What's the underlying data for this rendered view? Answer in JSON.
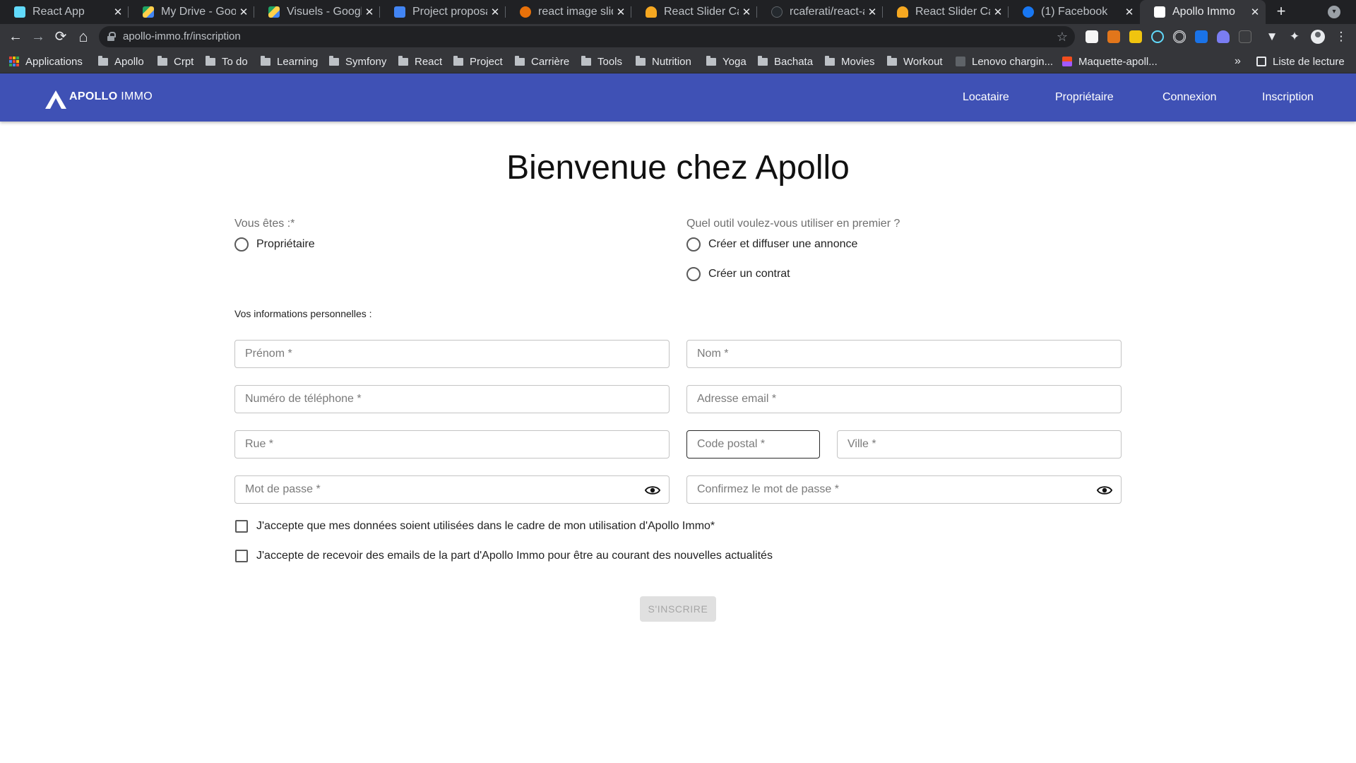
{
  "browser": {
    "tabs": [
      {
        "title": "React App",
        "favicon_color": "#61dafb"
      },
      {
        "title": "My Drive - Google Drive",
        "favicon_color": "#1fa463"
      },
      {
        "title": "Visuels - Google Drive",
        "favicon_color": "#ffd04b"
      },
      {
        "title": "Project proposal",
        "favicon_color": "#4285f4"
      },
      {
        "title": "react image slider",
        "favicon_color": "#e8710a"
      },
      {
        "title": "React Slider Card",
        "favicon_color": "#f6a821"
      },
      {
        "title": "rcaferati/react-awesome",
        "favicon_color": "#24292e"
      },
      {
        "title": "React Slider Card",
        "favicon_color": "#f6a821"
      },
      {
        "title": "(1) Facebook",
        "favicon_color": "#1877f2"
      },
      {
        "title": "Apollo Immo",
        "favicon_color": "#ffffff"
      }
    ],
    "close_glyph": "✕",
    "new_tab": "+",
    "url": "apollo-immo.fr/inscription",
    "nav": {
      "back": "←",
      "forward": "→",
      "reload": "⟳",
      "home": "⌂",
      "star": "☆",
      "puzzle": "✦",
      "menu": "⋮"
    },
    "bookmarks": [
      {
        "label": "Applications",
        "type": "apps"
      },
      {
        "label": "Apollo",
        "type": "folder"
      },
      {
        "label": "Crpt",
        "type": "folder"
      },
      {
        "label": "To do",
        "type": "folder"
      },
      {
        "label": "Learning",
        "type": "folder"
      },
      {
        "label": "Symfony",
        "type": "folder"
      },
      {
        "label": "React",
        "type": "folder"
      },
      {
        "label": "Project",
        "type": "folder"
      },
      {
        "label": "Carrière",
        "type": "folder"
      },
      {
        "label": "Tools",
        "type": "folder"
      },
      {
        "label": "Nutrition",
        "type": "folder"
      },
      {
        "label": "Yoga",
        "type": "folder"
      },
      {
        "label": "Bachata",
        "type": "folder"
      },
      {
        "label": "Movies",
        "type": "folder"
      },
      {
        "label": "Workout",
        "type": "folder"
      },
      {
        "label": "Lenovo chargin...",
        "type": "page"
      },
      {
        "label": "Maquette-apoll...",
        "type": "page"
      }
    ],
    "bookmarks_overflow": "»",
    "reading_list": "Liste de lecture"
  },
  "app": {
    "brand": {
      "bold": "APOLLO",
      "light": " IMMO"
    },
    "nav": [
      "Locataire",
      "Propriétaire",
      "Connexion",
      "Inscription"
    ],
    "colors": {
      "primary": "#3f51b5"
    }
  },
  "form": {
    "title": "Bienvenue chez Apollo",
    "user_type": {
      "label": "Vous êtes :*",
      "options": [
        "Propriétaire"
      ]
    },
    "tool": {
      "label": "Quel outil voulez-vous utiliser en premier ?",
      "options": [
        "Créer et diffuser une annonce",
        "Créer un contrat"
      ]
    },
    "section_label": "Vos informations personnelles :",
    "fields": {
      "first_name": "Prénom *",
      "last_name": "Nom *",
      "phone": "Numéro de téléphone *",
      "email": "Adresse email *",
      "street": "Rue *",
      "postal_code": "Code postal *",
      "city": "Ville *",
      "password": "Mot de passe *",
      "password_confirm": "Confirmez le mot de passe *"
    },
    "consents": [
      "J'accepte que mes données soient utilisées dans le cadre de mon utilisation d'Apollo Immo*",
      "J'accepte de recevoir des emails de la part d'Apollo Immo pour être au courant des nouvelles actualités"
    ],
    "submit": "S'INSCRIRE"
  }
}
